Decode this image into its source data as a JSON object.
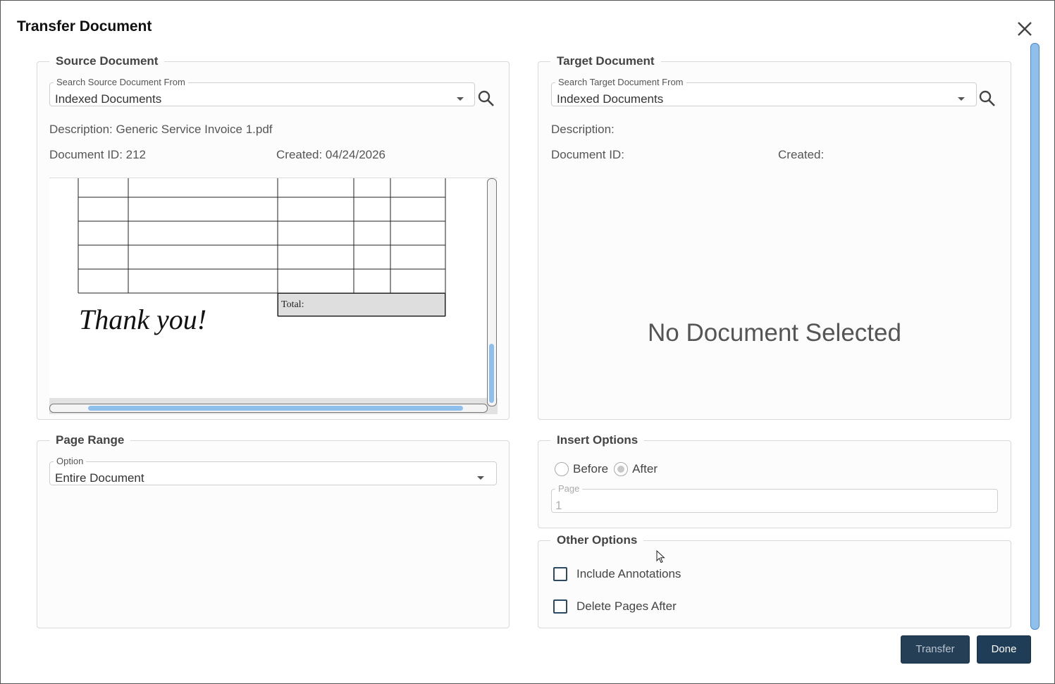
{
  "dialog": {
    "title": "Transfer Document"
  },
  "source": {
    "legend": "Source Document",
    "search_label": "Search Source Document From",
    "search_value": "Indexed Documents",
    "description": "Description: Generic Service Invoice 1.pdf",
    "document_id": "Document ID: 212",
    "created": "Created: 04/24/2026",
    "preview": {
      "total_label": "Total:",
      "thank_you": "Thank you!"
    }
  },
  "target": {
    "legend": "Target Document",
    "search_label": "Search Target Document From",
    "search_value": "Indexed Documents",
    "description": "Description:",
    "document_id": "Document ID:",
    "created": "Created:",
    "empty_message": "No Document Selected"
  },
  "page_range": {
    "legend": "Page Range",
    "option_label": "Option",
    "option_value": "Entire Document"
  },
  "insert_options": {
    "legend": "Insert Options",
    "before_label": "Before",
    "after_label": "After",
    "selected": "After",
    "page_label": "Page",
    "page_value": "1"
  },
  "other_options": {
    "legend": "Other Options",
    "include_annotations_label": "Include Annotations",
    "include_annotations_checked": false,
    "delete_pages_label": "Delete Pages After",
    "delete_pages_checked": false
  },
  "actions": {
    "transfer_label": "Transfer",
    "done_label": "Done"
  },
  "icons": {
    "close": "close-icon",
    "search": "search-icon",
    "dropdown": "chevron-down-icon"
  },
  "colors": {
    "primary_button": "#1f3d57",
    "scroll_thumb": "#8fc0ec"
  }
}
